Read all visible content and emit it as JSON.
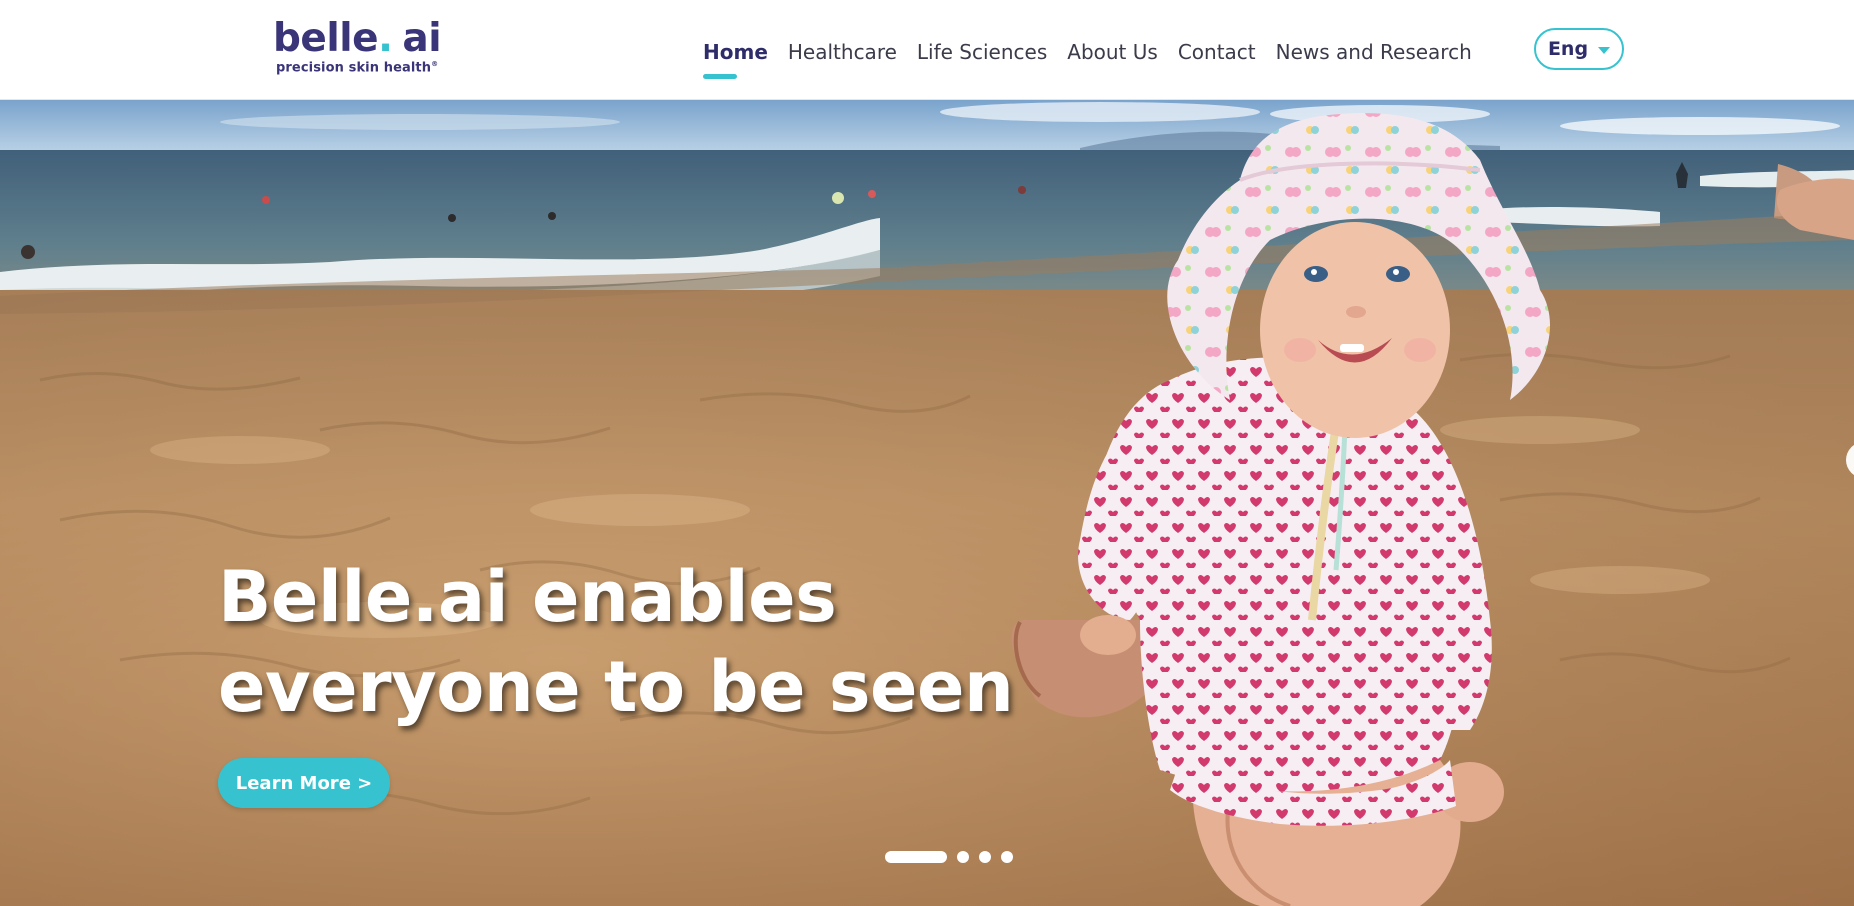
{
  "brand": {
    "name_part1": "belle",
    "name_dot": ".",
    "name_part2": "ai",
    "tagline": "precision skin health",
    "tagline_mark": "®",
    "colors": {
      "primary": "#3a3578",
      "accent": "#36c3cf"
    }
  },
  "nav": {
    "items": [
      {
        "label": "Home",
        "active": true
      },
      {
        "label": "Healthcare",
        "active": false
      },
      {
        "label": "Life Sciences",
        "active": false
      },
      {
        "label": "About Us",
        "active": false
      },
      {
        "label": "Contact",
        "active": false
      },
      {
        "label": "News and Research",
        "active": false
      }
    ]
  },
  "language": {
    "selected": "Eng",
    "icon": "chevron-down-icon"
  },
  "hero": {
    "headline_line1": "Belle.ai enables",
    "headline_line2": "everyone to be seen",
    "cta_label": "Learn More >",
    "slides": {
      "count": 4,
      "active_index": 1
    }
  }
}
